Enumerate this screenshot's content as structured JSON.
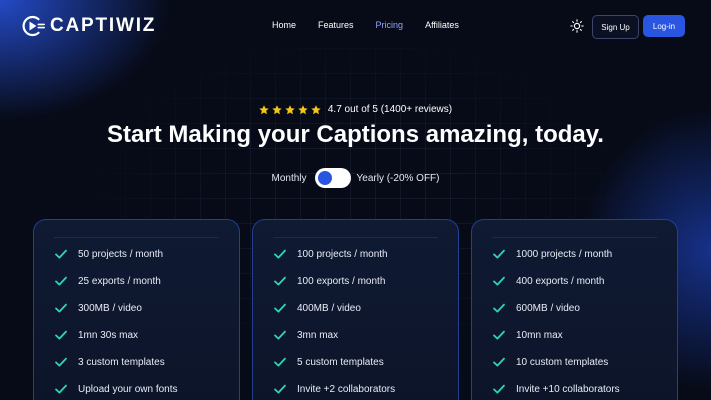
{
  "brand": {
    "name": "CAPTIWIZ",
    "logo_icon": "play-captions-icon"
  },
  "nav": {
    "items": [
      {
        "label": "Home",
        "active": false
      },
      {
        "label": "Features",
        "active": false
      },
      {
        "label": "Pricing",
        "active": true
      },
      {
        "label": "Affiliates",
        "active": false
      }
    ]
  },
  "header": {
    "theme_icon": "sun-icon",
    "signup_label": "Sign Up",
    "login_label": "Log-in"
  },
  "hero": {
    "stars": 5,
    "rating_text": "4.7 out of 5 (1400+ reviews)",
    "headline": "Start Making your Captions amazing, today."
  },
  "billing": {
    "monthly_label": "Monthly",
    "yearly_label": "Yearly (-20% OFF)",
    "selected": "Monthly"
  },
  "plans": [
    {
      "features": [
        "50 projects / month",
        "25 exports / month",
        "300MB / video",
        "1mn 30s max",
        "3 custom templates",
        "Upload your own fonts"
      ]
    },
    {
      "features": [
        "100 projects / month",
        "100 exports / month",
        "400MB / video",
        "3mn max",
        "5 custom templates",
        "Invite +2 collaborators"
      ]
    },
    {
      "features": [
        "1000 projects / month",
        "400 exports / month",
        "600MB / video",
        "10mn max",
        "10 custom templates",
        "Invite +10 collaborators"
      ]
    }
  ],
  "colors": {
    "accent": "#2a55e0",
    "active_nav": "#8fa7ff",
    "star": "#f5c518",
    "check": "#2fd6b4",
    "card_border": "#233f8f",
    "background": "#070b18"
  }
}
